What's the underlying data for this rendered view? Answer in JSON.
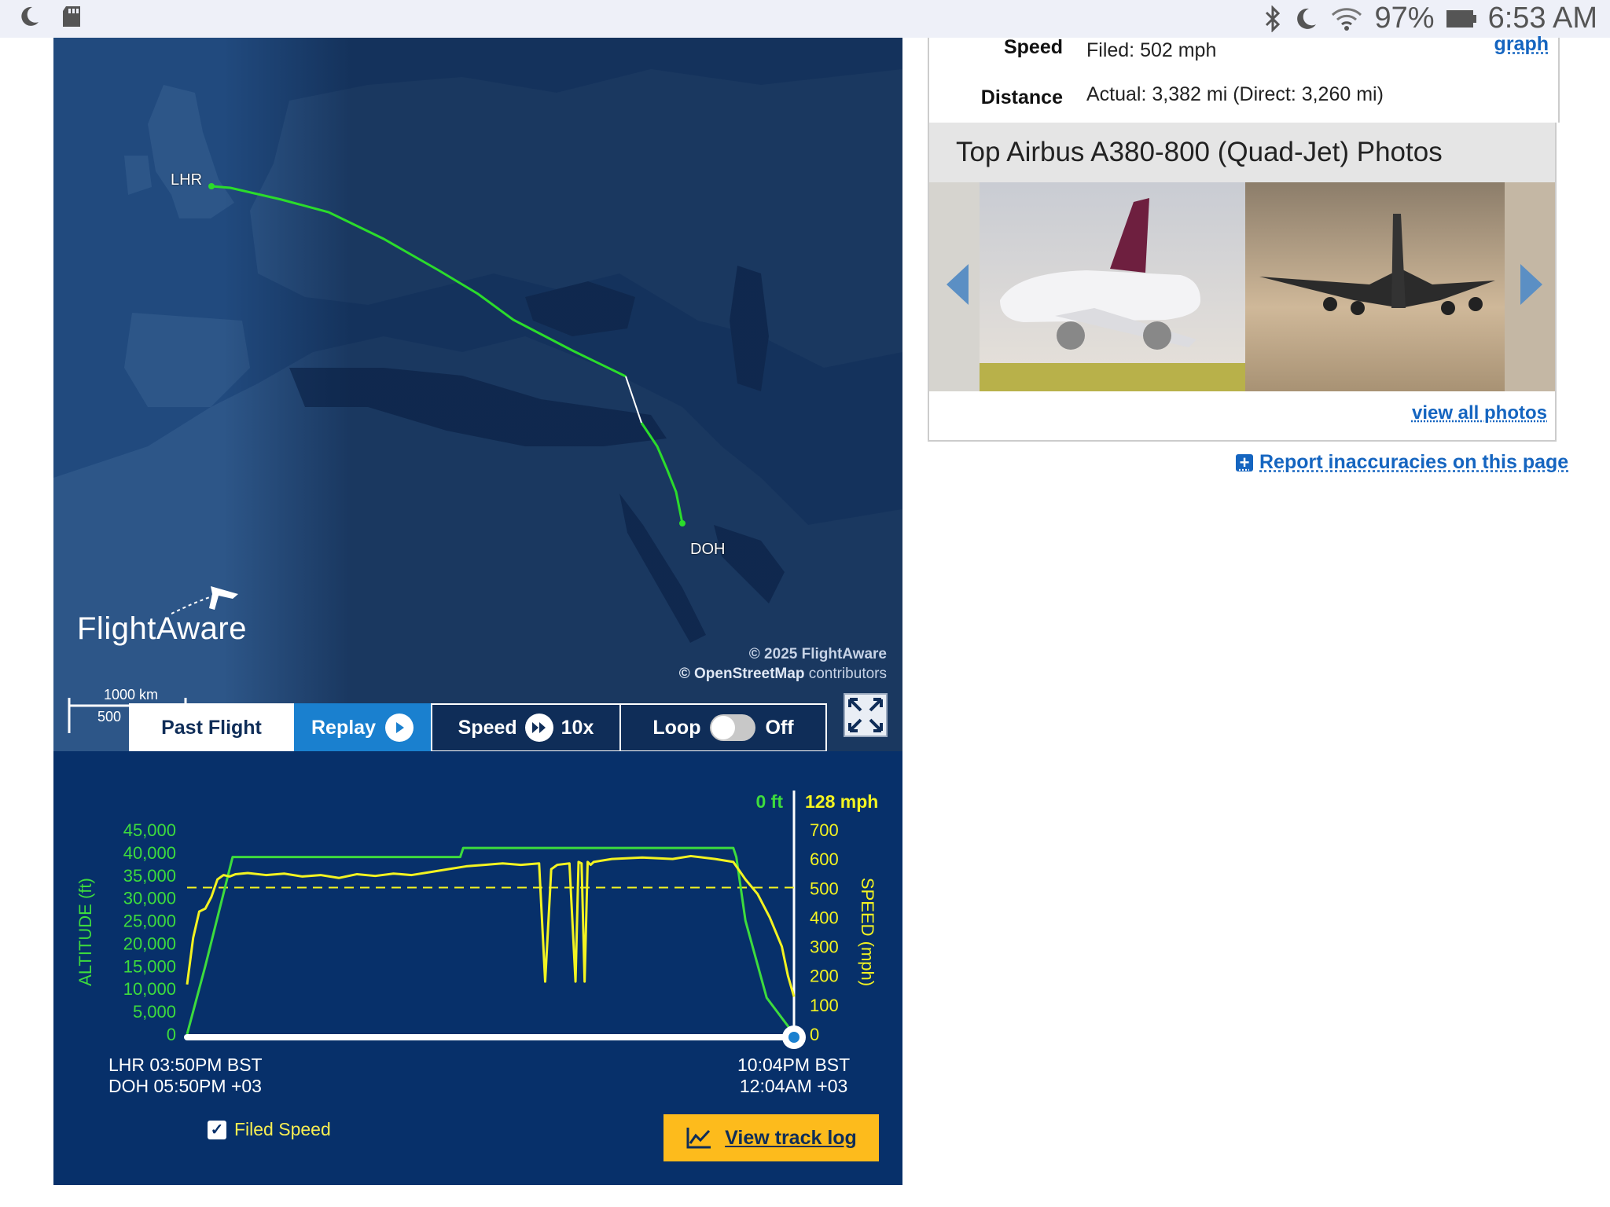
{
  "status_bar": {
    "battery": "97%",
    "time": "6:53 AM"
  },
  "map": {
    "origin_code": "LHR",
    "destination_code": "DOH",
    "logo": "FlightAware",
    "credit_line1": "© 2025 FlightAware",
    "credit_osm": "© OpenStreetMap",
    "credit_contributors": "contributors",
    "scale_km": "1000 km",
    "scale_mi": "500",
    "route_color": "#2bdc2b"
  },
  "controls": {
    "past_flight": "Past Flight",
    "replay": "Replay",
    "speed_label": "Speed",
    "speed_value": "10x",
    "loop_label": "Loop",
    "loop_value": "Off"
  },
  "chart_data": {
    "type": "line",
    "ylabel_left": "ALTITUDE (ft)",
    "ylabel_right": "SPEED (mph)",
    "left_ticks": [
      "45,000",
      "40,000",
      "35,000",
      "30,000",
      "25,000",
      "20,000",
      "15,000",
      "10,000",
      "5,000",
      "0"
    ],
    "right_ticks": [
      "700",
      "600",
      "500",
      "400",
      "300",
      "200",
      "100",
      "0"
    ],
    "ylim_left": [
      0,
      45000
    ],
    "ylim_right": [
      0,
      700
    ],
    "current_altitude": "0 ft",
    "current_speed": "128 mph",
    "filed_speed_mph": 502,
    "colors": {
      "altitude": "#3ddc3d",
      "speed": "#f3f321",
      "filed": "#f3f321",
      "axis": "#ffffff"
    },
    "series": [
      {
        "name": "Altitude",
        "t": [
          0,
          0.03,
          0.075,
          0.45,
          0.455,
          0.9,
          0.905,
          0.92,
          0.955,
          1.0
        ],
        "values": [
          0,
          15000,
          39000,
          39000,
          41000,
          41000,
          39000,
          25000,
          8000,
          0
        ]
      },
      {
        "name": "Speed",
        "t": [
          0,
          0.01,
          0.02,
          0.03,
          0.04,
          0.05,
          0.06,
          0.07,
          0.08,
          0.1,
          0.13,
          0.16,
          0.19,
          0.22,
          0.25,
          0.28,
          0.31,
          0.34,
          0.37,
          0.4,
          0.43,
          0.46,
          0.49,
          0.52,
          0.55,
          0.58,
          0.59,
          0.6,
          0.61,
          0.63,
          0.64,
          0.645,
          0.65,
          0.655,
          0.66,
          0.665,
          0.67,
          0.7,
          0.75,
          0.8,
          0.83,
          0.87,
          0.9,
          0.92,
          0.94,
          0.96,
          0.98,
          0.99,
          1.0
        ],
        "values": [
          170,
          330,
          420,
          430,
          470,
          530,
          545,
          540,
          548,
          552,
          545,
          550,
          540,
          545,
          535,
          548,
          542,
          550,
          545,
          555,
          565,
          575,
          580,
          585,
          580,
          585,
          180,
          565,
          580,
          585,
          180,
          590,
          585,
          180,
          590,
          580,
          590,
          600,
          605,
          600,
          610,
          600,
          590,
          530,
          480,
          400,
          300,
          200,
          128
        ]
      }
    ],
    "time_start_origin": "LHR 03:50PM BST",
    "time_start_dest": "DOH 05:50PM +03",
    "time_end_origin": "10:04PM BST",
    "time_end_dest": "12:04AM +03"
  },
  "chart_footer": {
    "filed_speed_label": "Filed Speed",
    "track_log_button": "View track log"
  },
  "info": {
    "speed_label": "Speed",
    "speed_value": "Filed: 502 mph",
    "graph_link": "graph",
    "distance_label": "Distance",
    "distance_value": "Actual: 3,382 mi (Direct: 3,260 mi)"
  },
  "photos": {
    "title": "Top Airbus A380-800 (Quad-Jet) Photos",
    "view_all": "view all photos"
  },
  "report_link": "Report inaccuracies on this page"
}
